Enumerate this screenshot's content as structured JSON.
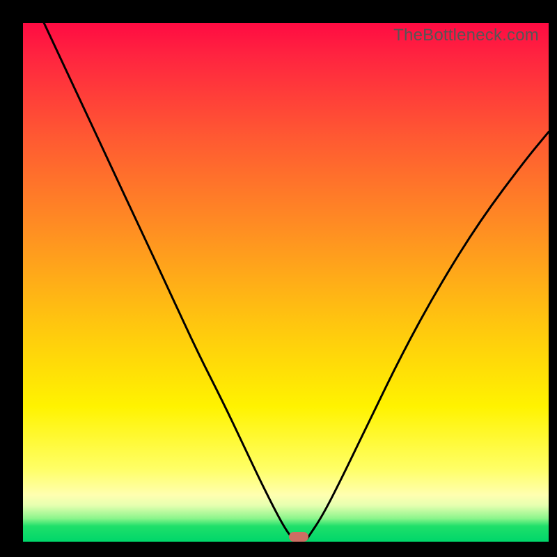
{
  "watermark": "TheBottleneck.com",
  "marker": {
    "x_frac": 0.525,
    "y_frac": 0.99
  },
  "chart_data": {
    "type": "line",
    "title": "",
    "xlabel": "",
    "ylabel": "",
    "xlim": [
      0,
      1
    ],
    "ylim": [
      0,
      1
    ],
    "series": [
      {
        "name": "left-branch",
        "x": [
          0.04,
          0.1,
          0.16,
          0.22,
          0.28,
          0.33,
          0.38,
          0.42,
          0.455,
          0.485,
          0.505,
          0.516
        ],
        "y": [
          1.0,
          0.87,
          0.74,
          0.61,
          0.48,
          0.37,
          0.27,
          0.185,
          0.11,
          0.05,
          0.015,
          0.005
        ]
      },
      {
        "name": "valley-floor",
        "x": [
          0.516,
          0.54
        ],
        "y": [
          0.005,
          0.005
        ]
      },
      {
        "name": "right-branch",
        "x": [
          0.54,
          0.57,
          0.61,
          0.66,
          0.72,
          0.79,
          0.87,
          0.955,
          1.0
        ],
        "y": [
          0.005,
          0.05,
          0.13,
          0.235,
          0.36,
          0.49,
          0.62,
          0.735,
          0.79
        ]
      }
    ],
    "gradient_stops": [
      {
        "pos": 0.0,
        "color": "#ff0b42"
      },
      {
        "pos": 0.4,
        "color": "#ff8f22"
      },
      {
        "pos": 0.74,
        "color": "#fff300"
      },
      {
        "pos": 0.93,
        "color": "#e6ffb0"
      },
      {
        "pos": 1.0,
        "color": "#00d66a"
      }
    ]
  }
}
